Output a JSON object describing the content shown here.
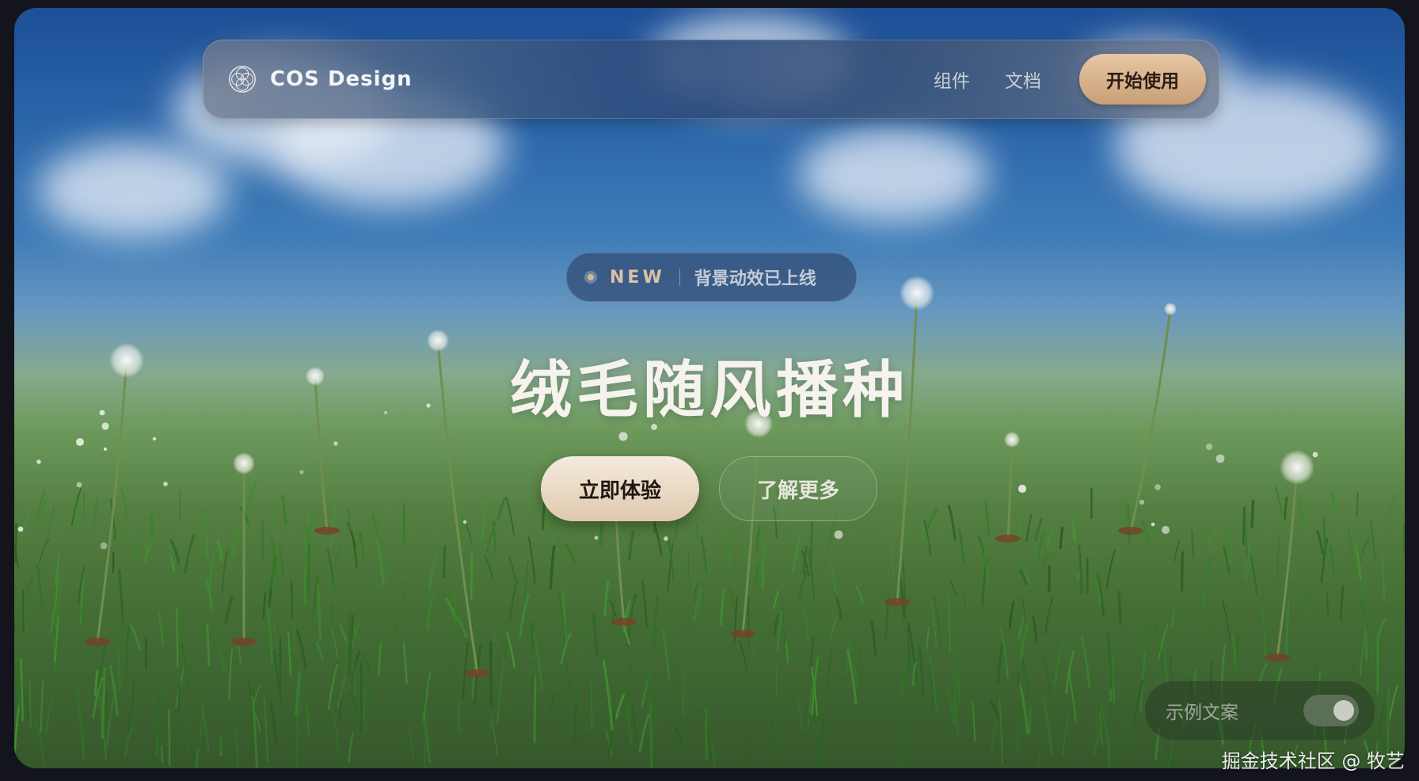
{
  "brand": {
    "name": "COS Design",
    "logo_icon": "cos-logo-icon"
  },
  "nav": {
    "links": [
      {
        "label": "组件"
      },
      {
        "label": "文档"
      }
    ],
    "cta_label": "开始使用"
  },
  "hero": {
    "badge_tag": "NEW",
    "badge_text": "背景动效已上线",
    "title": "绒毛随风播种",
    "primary_button": "立即体验",
    "secondary_button": "了解更多"
  },
  "sample_toggle": {
    "label": "示例文案",
    "enabled": true
  },
  "watermark": "掘金技术社区 @ 牧艺",
  "colors": {
    "accent": "#d8b48e",
    "sky_top": "#1d4f96",
    "grass": "#4b7537"
  }
}
